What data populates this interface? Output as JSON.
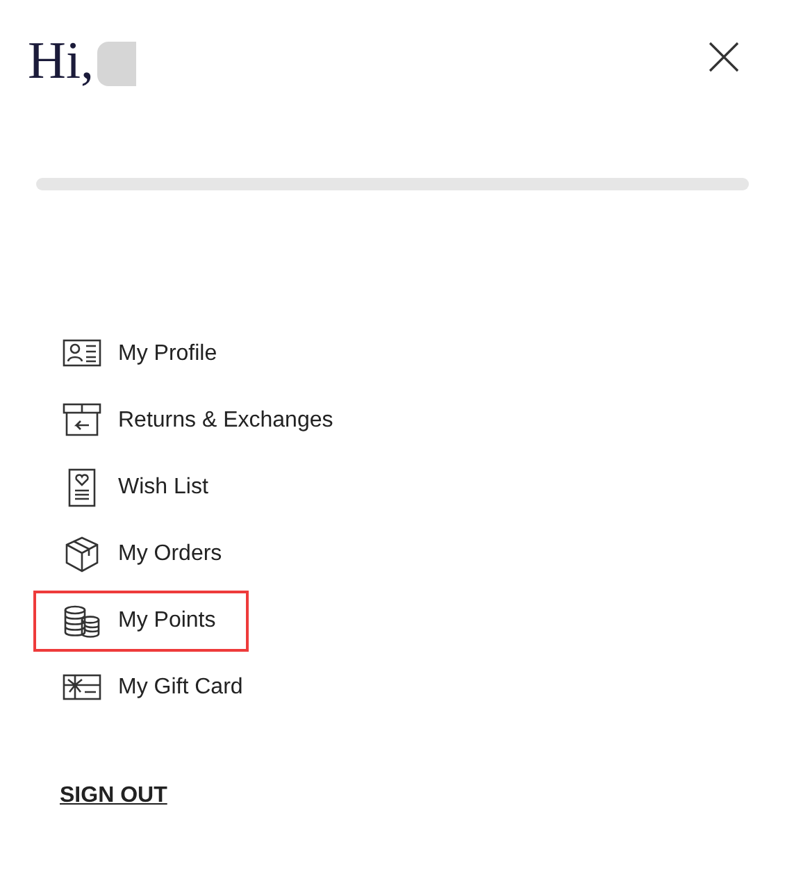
{
  "greeting": "Hi,",
  "menu": [
    {
      "label": "My Profile",
      "highlighted": false
    },
    {
      "label": "Returns & Exchanges",
      "highlighted": false
    },
    {
      "label": "Wish List",
      "highlighted": false
    },
    {
      "label": "My Orders",
      "highlighted": false
    },
    {
      "label": "My Points",
      "highlighted": true
    },
    {
      "label": "My Gift Card",
      "highlighted": false
    }
  ],
  "sign_out": "SIGN OUT"
}
